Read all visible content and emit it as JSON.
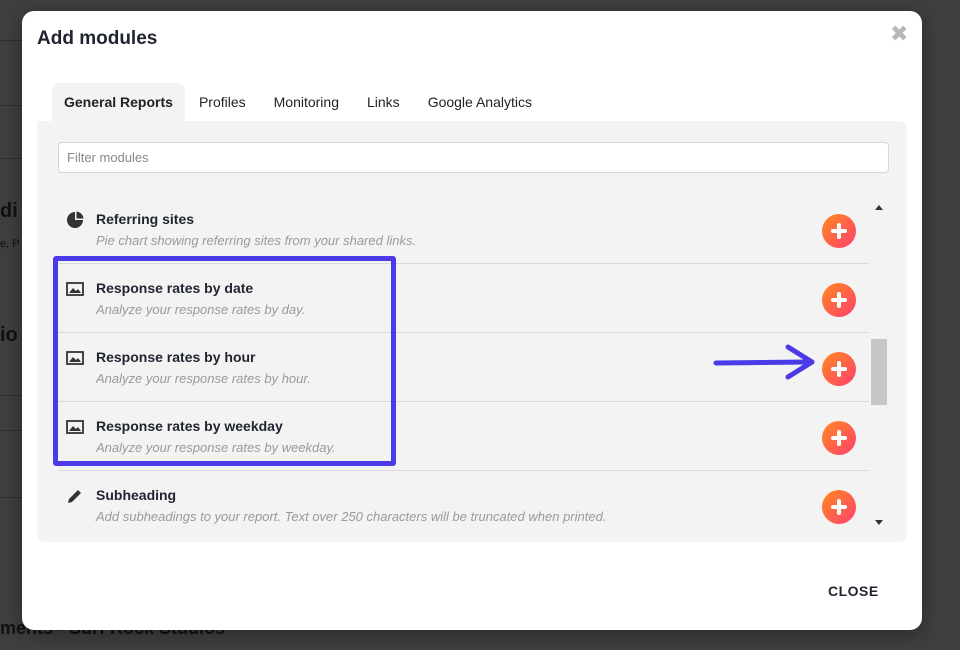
{
  "modal": {
    "title": "Add modules",
    "close_button": "CLOSE"
  },
  "tabs": [
    {
      "label": "General Reports",
      "active": true
    },
    {
      "label": "Profiles",
      "active": false
    },
    {
      "label": "Monitoring",
      "active": false
    },
    {
      "label": "Links",
      "active": false
    },
    {
      "label": "Google Analytics",
      "active": false
    }
  ],
  "filter": {
    "placeholder": "Filter modules",
    "value": ""
  },
  "modules": [
    {
      "title": "Referring sites",
      "description": "Pie chart showing referring sites from your shared links.",
      "icon": "pie-chart-icon"
    },
    {
      "title": "Response rates by date",
      "description": "Analyze your response rates by day.",
      "icon": "image-icon"
    },
    {
      "title": "Response rates by hour",
      "description": "Analyze your response rates by hour.",
      "icon": "image-icon"
    },
    {
      "title": "Response rates by weekday",
      "description": "Analyze your response rates by weekday.",
      "icon": "image-icon"
    },
    {
      "title": "Subheading",
      "description": "Add subheadings to your report. Text over 250 characters will be truncated when printed.",
      "icon": "pencil-icon"
    }
  ],
  "backdrop": {
    "fragments": [
      "di",
      "e, P",
      "io",
      "ments - Surf Rock Studios"
    ]
  },
  "colors": {
    "highlight": "#4a3ae8",
    "add_gradient_start": "#ff8a1f",
    "add_gradient_end": "#ff3f6e"
  }
}
